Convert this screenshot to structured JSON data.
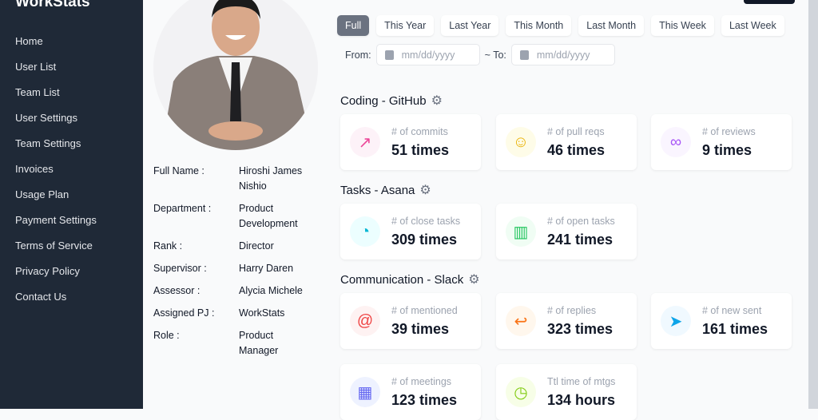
{
  "app": {
    "title": "WorkStats"
  },
  "sidebar": {
    "items": [
      "Home",
      "User List",
      "Team List",
      "User Settings",
      "Team Settings",
      "Invoices",
      "Usage Plan",
      "Payment Settings",
      "Terms of Service",
      "Privacy Policy",
      "Contact Us"
    ]
  },
  "profile": [
    {
      "k": "Full Name :",
      "v": "Hiroshi James Nishio"
    },
    {
      "k": "Department :",
      "v": "Product Development"
    },
    {
      "k": "Rank :",
      "v": "Director"
    },
    {
      "k": "Supervisor :",
      "v": "Harry Daren"
    },
    {
      "k": "Assessor :",
      "v": "Alycia Michele"
    },
    {
      "k": "Assigned PJ :",
      "v": "WorkStats"
    },
    {
      "k": "Role :",
      "v": "Product Manager"
    }
  ],
  "ranges": [
    "Full",
    "This Year",
    "Last Year",
    "This Month",
    "Last Month",
    "This Week",
    "Last Week"
  ],
  "dates": {
    "from_label": "From:",
    "to_label": "~ To:",
    "placeholder": "mm/dd/yyyy"
  },
  "sections": {
    "coding": "Coding - GitHub",
    "tasks": "Tasks - Asana",
    "comm": "Communication - Slack"
  },
  "cards": [
    {
      "label": "# of commits",
      "value": "51 times",
      "icon": "trend-icon",
      "color": "#ec4899",
      "bg": "#fdf2f8"
    },
    {
      "label": "# of pull reqs",
      "value": "46 times",
      "icon": "user-icon",
      "color": "#eab308",
      "bg": "#fefce8"
    },
    {
      "label": "# of reviews",
      "value": "9 times",
      "icon": "glasses-icon",
      "color": "#a855f7",
      "bg": "#faf5ff"
    },
    {
      "label": "# of close tasks",
      "value": "309 times",
      "icon": "pie-icon",
      "color": "#06b6d4",
      "bg": "#ecfeff"
    },
    {
      "label": "# of open tasks",
      "value": "241 times",
      "icon": "bar-chart-icon",
      "color": "#22c55e",
      "bg": "#f0fdf4"
    },
    {
      "label": "# of mentioned",
      "value": "39 times",
      "icon": "at-icon",
      "color": "#ef4444",
      "bg": "#fef2f2"
    },
    {
      "label": "# of replies",
      "value": "323 times",
      "icon": "reply-icon",
      "color": "#f97316",
      "bg": "#fff7ed"
    },
    {
      "label": "# of new sent",
      "value": "161 times",
      "icon": "send-icon",
      "color": "#0ea5e9",
      "bg": "#f0f9ff"
    },
    {
      "label": "# of meetings",
      "value": "123 times",
      "icon": "calendar-icon",
      "color": "#6366f1",
      "bg": "#eef2ff"
    },
    {
      "label": "Ttl time of mtgs",
      "value": "134 hours",
      "icon": "clock-icon",
      "color": "#84cc16",
      "bg": "#f7fee7"
    }
  ]
}
